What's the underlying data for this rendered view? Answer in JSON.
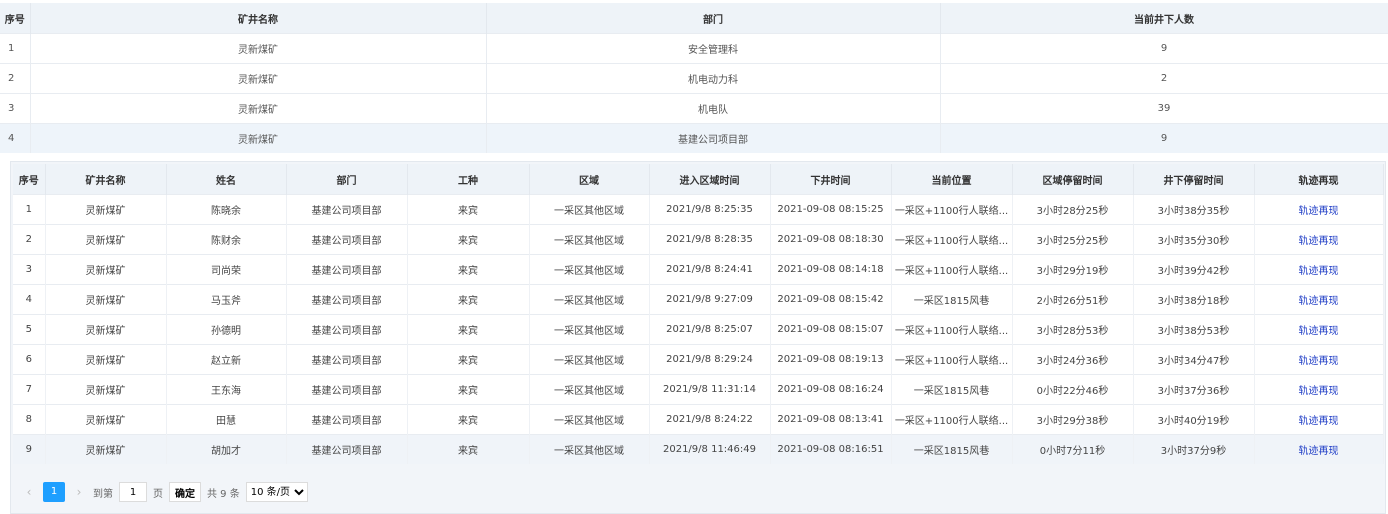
{
  "summary": {
    "headers": [
      "序号",
      "矿井名称",
      "部门",
      "当前井下人数"
    ],
    "rows": [
      [
        "1",
        "灵新煤矿",
        "安全管理科",
        "9"
      ],
      [
        "2",
        "灵新煤矿",
        "机电动力科",
        "2"
      ],
      [
        "3",
        "灵新煤矿",
        "机电队",
        "39"
      ],
      [
        "4",
        "灵新煤矿",
        "基建公司项目部",
        "9"
      ]
    ]
  },
  "detail": {
    "headers": [
      "序号",
      "矿井名称",
      "姓名",
      "部门",
      "工种",
      "区域",
      "进入区域时间",
      "下井时间",
      "当前位置",
      "区域停留时间",
      "井下停留时间",
      "轨迹再现"
    ],
    "rows": [
      [
        "1",
        "灵新煤矿",
        "陈晓余",
        "基建公司项目部",
        "来宾",
        "一采区其他区域",
        "2021/9/8 8:25:35",
        "2021-09-08 08:15:25",
        "一采区+1100行人联络...",
        "3小时28分25秒",
        "3小时38分35秒",
        "轨迹再现"
      ],
      [
        "2",
        "灵新煤矿",
        "陈财余",
        "基建公司项目部",
        "来宾",
        "一采区其他区域",
        "2021/9/8 8:28:35",
        "2021-09-08 08:18:30",
        "一采区+1100行人联络...",
        "3小时25分25秒",
        "3小时35分30秒",
        "轨迹再现"
      ],
      [
        "3",
        "灵新煤矿",
        "司尚荣",
        "基建公司项目部",
        "来宾",
        "一采区其他区域",
        "2021/9/8 8:24:41",
        "2021-09-08 08:14:18",
        "一采区+1100行人联络...",
        "3小时29分19秒",
        "3小时39分42秒",
        "轨迹再现"
      ],
      [
        "4",
        "灵新煤矿",
        "马玉斧",
        "基建公司项目部",
        "来宾",
        "一采区其他区域",
        "2021/9/8 9:27:09",
        "2021-09-08 08:15:42",
        "一采区1815风巷",
        "2小时26分51秒",
        "3小时38分18秒",
        "轨迹再现"
      ],
      [
        "5",
        "灵新煤矿",
        "孙德明",
        "基建公司项目部",
        "来宾",
        "一采区其他区域",
        "2021/9/8 8:25:07",
        "2021-09-08 08:15:07",
        "一采区+1100行人联络...",
        "3小时28分53秒",
        "3小时38分53秒",
        "轨迹再现"
      ],
      [
        "6",
        "灵新煤矿",
        "赵立新",
        "基建公司项目部",
        "来宾",
        "一采区其他区域",
        "2021/9/8 8:29:24",
        "2021-09-08 08:19:13",
        "一采区+1100行人联络...",
        "3小时24分36秒",
        "3小时34分47秒",
        "轨迹再现"
      ],
      [
        "7",
        "灵新煤矿",
        "王东海",
        "基建公司项目部",
        "来宾",
        "一采区其他区域",
        "2021/9/8 11:31:14",
        "2021-09-08 08:16:24",
        "一采区1815风巷",
        "0小时22分46秒",
        "3小时37分36秒",
        "轨迹再现"
      ],
      [
        "8",
        "灵新煤矿",
        "田慧",
        "基建公司项目部",
        "来宾",
        "一采区其他区域",
        "2021/9/8 8:24:22",
        "2021-09-08 08:13:41",
        "一采区+1100行人联络...",
        "3小时29分38秒",
        "3小时40分19秒",
        "轨迹再现"
      ],
      [
        "9",
        "灵新煤矿",
        "胡加才",
        "基建公司项目部",
        "来宾",
        "一采区其他区域",
        "2021/9/8 11:46:49",
        "2021-09-08 08:16:51",
        "一采区1815风巷",
        "0小时7分11秒",
        "3小时37分9秒",
        "轨迹再现"
      ]
    ]
  },
  "pagination": {
    "prev_icon": "‹",
    "current_page": "1",
    "next_icon": "›",
    "goto_label": "到第",
    "goto_value": "1",
    "page_unit": "页",
    "confirm_label": "确定",
    "total_label": "共 9 条",
    "page_size": "10 条/页"
  },
  "colors": {
    "link": "#1e3cc6",
    "active_page": "#1e9fff",
    "header_bg": "#eef3f8"
  }
}
